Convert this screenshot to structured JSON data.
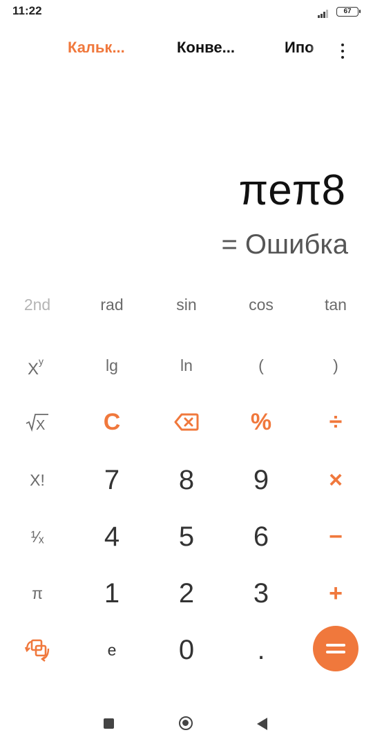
{
  "status_bar": {
    "time": "11:22",
    "battery": "67"
  },
  "tabs": [
    {
      "label": "Кальк...",
      "active": true
    },
    {
      "label": "Конве...",
      "active": false
    },
    {
      "label": "Ипо",
      "active": false
    }
  ],
  "display": {
    "expression": "πeπ8",
    "result": "= Ошибка"
  },
  "keys": {
    "second": "2nd",
    "rad": "rad",
    "sin": "sin",
    "cos": "cos",
    "tan": "tan",
    "lg": "lg",
    "ln": "ln",
    "open_paren": "(",
    "close_paren": ")",
    "clear": "C",
    "percent": "%",
    "divide": "÷",
    "factorial": "X!",
    "multiply": "×",
    "reciprocal": "¹⁄ₓ",
    "minus": "−",
    "pi": "π",
    "plus": "+",
    "e": "e",
    "dot": ".",
    "digits": {
      "0": "0",
      "1": "1",
      "2": "2",
      "3": "3",
      "4": "4",
      "5": "5",
      "6": "6",
      "7": "7",
      "8": "8",
      "9": "9"
    }
  },
  "colors": {
    "accent": "#f0783c",
    "text": "#333333",
    "sci_text": "#6a6a6a"
  }
}
